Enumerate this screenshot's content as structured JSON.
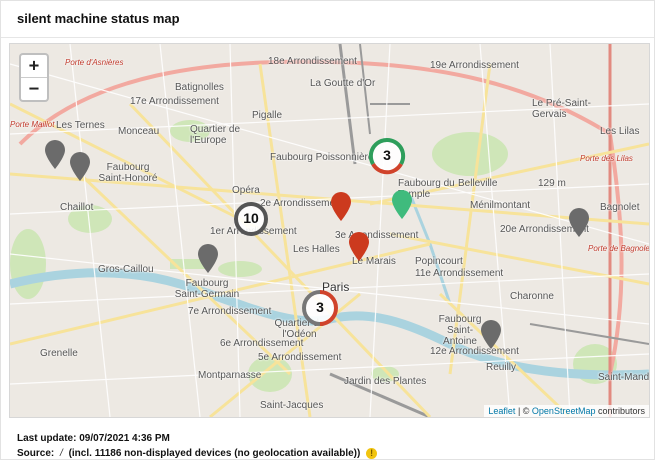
{
  "header": {
    "title": "silent machine status map"
  },
  "map": {
    "zoom_in_label": "+",
    "zoom_out_label": "−",
    "labels": {
      "porte_asnieres": "Porte d'Asnières",
      "arr18": "18e Arrondissement",
      "arr19": "19e Arrondissement",
      "batignolles": "Batignolles",
      "goutte_dor": "La Goutte d'Or",
      "arr17": "17e Arrondissement",
      "pigalle": "Pigalle",
      "pre_st_gervais": "Le Pré-Saint-Gervais",
      "ternes": "Les Ternes",
      "monceau": "Monceau",
      "quartier_europe": "Quartier de l'Europe",
      "lilas": "Les Lilas",
      "faubourg_poissonniere": "Faubourg Poissonnière",
      "porte_maillot": "Porte Maillot",
      "porte_lilas": "Porte des Lilas",
      "faubourg_st_honore": "Faubourg Saint-Honoré",
      "belleville": "Belleville",
      "faubourg_temple": "Faubourg du Temple",
      "opera": "Opéra",
      "arr2": "2e Arrondissement",
      "chaillot": "Chaillot",
      "menilmontant": "Ménilmontant",
      "bagnolet": "Bagnolet",
      "arr1": "1er Arrondissement",
      "arr3": "3e Arrondissement",
      "arr20": "20e Arrondissement",
      "halles": "Les Halles",
      "porte_bagnolet": "Porte de Bagnolet",
      "gros_caillou": "Gros-Caillou",
      "marais": "Le Marais",
      "popincourt": "Popincourt",
      "arr11": "11e Arrondissement",
      "faubourg_st_germain": "Faubourg Saint-Germain",
      "paris": "Paris",
      "charonne": "Charonne",
      "arr7": "7e Arrondissement",
      "quartier_odeon": "Quartier de l'Odéon",
      "faubourg_st_antoine": "Faubourg Saint-Antoine",
      "grenelle": "Grenelle",
      "arr5": "5e Arrondissement",
      "arr6": "6e Arrondissement",
      "arr12": "12e Arrondissement",
      "reuilly": "Reuilly",
      "montparnasse": "Montparnasse",
      "st_mande": "Saint-Mandé",
      "jardin_plantes": "Jardin des Plantes",
      "st_jacques": "Saint-Jacques",
      "montreuil": "129 m"
    },
    "clusters": [
      {
        "count": "3",
        "color_a": "#2e9e5b",
        "color_b": "#d0432b"
      },
      {
        "count": "10",
        "color_a": "#555555",
        "color_b": "#555555"
      },
      {
        "count": "3",
        "color_a": "#d0432b",
        "color_b": "#777777"
      }
    ],
    "marker_colors": {
      "grey": "#6b6b6b",
      "red": "#cc3a1e",
      "green": "#3fbb7d"
    },
    "attribution": {
      "leaflet": "Leaflet",
      "separator": " | © ",
      "osm": "OpenStreetMap",
      "suffix": " contributors"
    }
  },
  "footer": {
    "last_update_label": "Last update:",
    "last_update_value": "09/07/2021 4:36 PM",
    "source_label": "Source:",
    "source_icon": "/",
    "source_text": "(incl. 11186 non-displayed devices (no geolocation available))",
    "warning_icon": "!"
  }
}
